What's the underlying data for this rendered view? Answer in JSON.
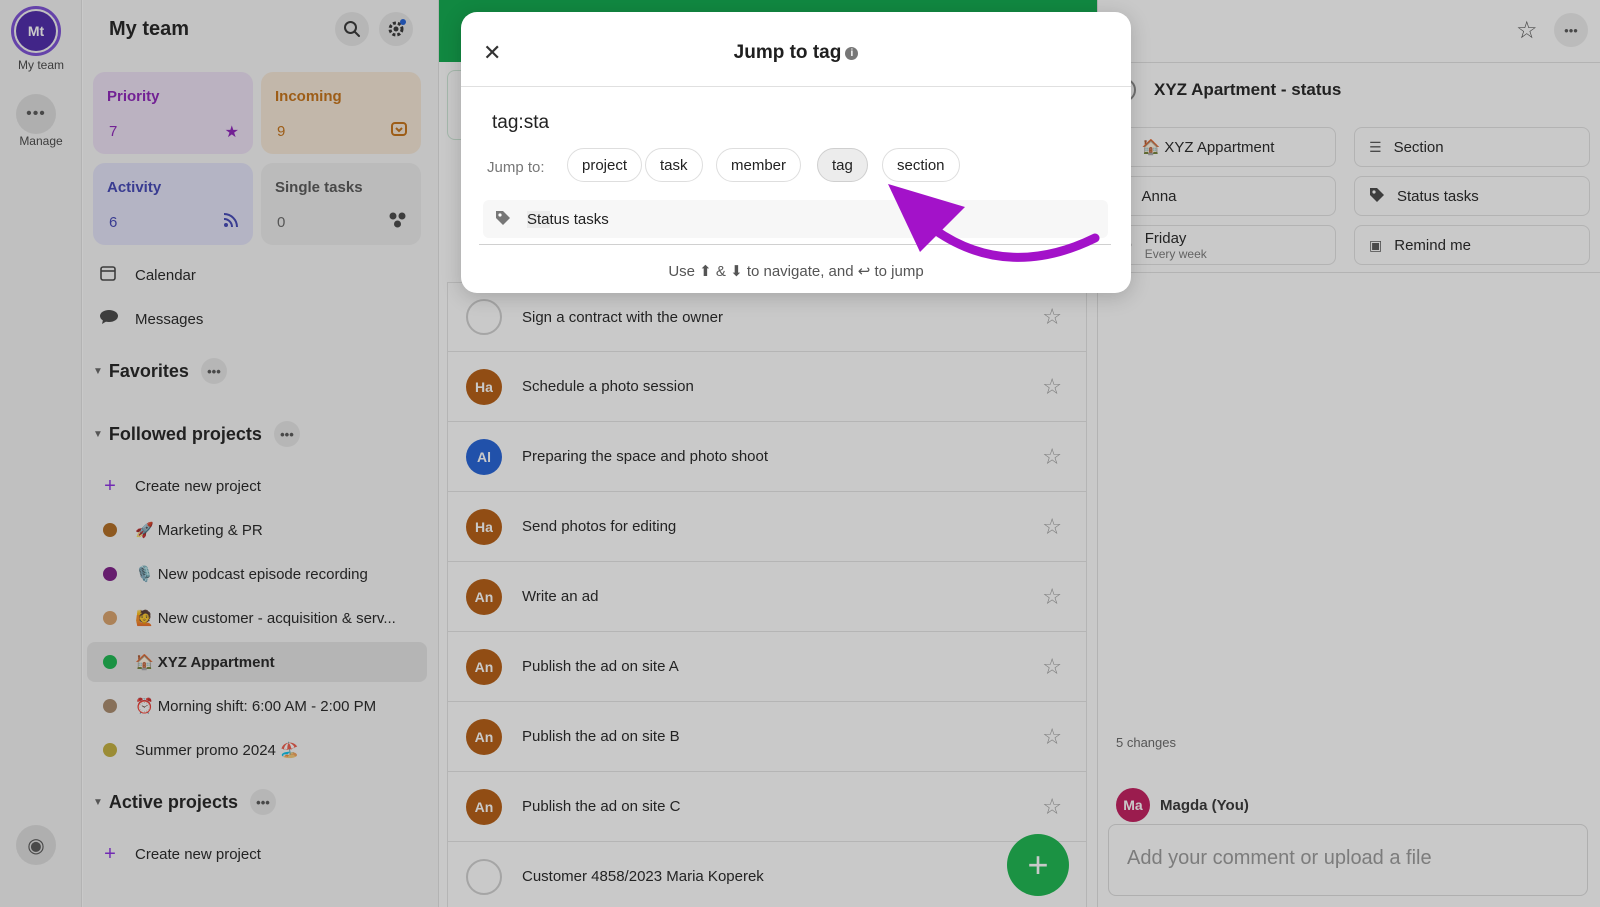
{
  "rail": {
    "team_initials": "Mt",
    "team_label": "My team",
    "manage_label": "Manage"
  },
  "sidebar": {
    "title": "My team",
    "tiles": [
      {
        "name": "Priority",
        "count": "7",
        "icon": "star-icon",
        "bg": "#ece0f5",
        "color": "#8b1fb8"
      },
      {
        "name": "Incoming",
        "count": "9",
        "icon": "inbox-icon",
        "bg": "#f6e7d6",
        "color": "#c46f12"
      },
      {
        "name": "Activity",
        "count": "6",
        "icon": "rss-icon",
        "bg": "#e3e3f8",
        "color": "#3f43b5"
      },
      {
        "name": "Single tasks",
        "count": "0",
        "icon": "dots-cluster-icon",
        "bg": "#ececec",
        "color": "#555555"
      }
    ],
    "nav": [
      {
        "label": "Calendar",
        "icon": "calendar-icon"
      },
      {
        "label": "Messages",
        "icon": "chat-icon"
      }
    ],
    "favorites_label": "Favorites",
    "followed_label": "Followed projects",
    "followed": [
      {
        "label": "Create new project",
        "type": "create"
      },
      {
        "label": "Marketing & PR",
        "emoji": "🚀",
        "color": "#b06a1e"
      },
      {
        "label": "New podcast episode recording",
        "emoji": "🎙️",
        "color": "#7b1a86"
      },
      {
        "label": "New customer - acquisition & serv...",
        "emoji": "🙋",
        "color": "#d8a068"
      },
      {
        "label": "XYZ Appartment",
        "emoji": "🏠",
        "color": "#17b64c",
        "active": true
      },
      {
        "label": "Morning shift: 6:00 AM - 2:00 PM",
        "emoji": "⏰",
        "color": "#a7886a"
      },
      {
        "label": "Summer promo 2024 🏖️",
        "emoji": "",
        "color": "#c2ae3a"
      }
    ],
    "active_label": "Active projects",
    "active": [
      {
        "label": "Create new project",
        "type": "create"
      }
    ]
  },
  "tasks": [
    {
      "text": "Sign a contract with the owner",
      "initials": "",
      "color": ""
    },
    {
      "text": "Schedule a photo session",
      "initials": "Ha",
      "color": "#b45a0e"
    },
    {
      "text": "Preparing the space and photo shoot",
      "initials": "Al",
      "color": "#1f5fd6"
    },
    {
      "text": "Send photos for editing",
      "initials": "Ha",
      "color": "#b45a0e"
    },
    {
      "text": "Write an ad",
      "initials": "An",
      "color": "#b45a0e"
    },
    {
      "text": "Publish the ad on site A",
      "initials": "An",
      "color": "#b45a0e"
    },
    {
      "text": "Publish the ad on site B",
      "initials": "An",
      "color": "#b45a0e"
    },
    {
      "text": "Publish the ad on site C",
      "initials": "An",
      "color": "#b45a0e"
    },
    {
      "text": "Customer 4858/2023 Maria Koperek",
      "initials": "",
      "color": ""
    }
  ],
  "detail": {
    "title": "XYZ Apartment - status",
    "chips": [
      {
        "label": "🏠 XYZ Appartment",
        "icon": "project-dot-icon"
      },
      {
        "label": "Section",
        "icon": "section-icon"
      },
      {
        "label": "Anna",
        "icon": "assignee-icon"
      },
      {
        "label": "Status tasks",
        "icon": "tag-icon"
      },
      {
        "label": "Friday",
        "sub": "Every week",
        "icon": "repeat-icon"
      },
      {
        "label": "Remind me",
        "icon": "reminder-icon"
      }
    ],
    "changes": "5 changes",
    "commenter_initials": "Ma",
    "commenter_name": "Magda (You)",
    "comment_placeholder": "Add your comment or upload a file"
  },
  "modal": {
    "title": "Jump to tag",
    "query": "tag:sta",
    "jump_to_label": "Jump to:",
    "pills": [
      "project",
      "task",
      "member",
      "tag",
      "section"
    ],
    "selected_pill": "tag",
    "result_highlight": "Sta",
    "result_rest": "tus tasks",
    "hint": "Use ⬆ & ⬇ to navigate, and ↩ to jump"
  },
  "colors": {
    "accent_green": "#17b64c",
    "arrow_purple": "#a312c9"
  }
}
